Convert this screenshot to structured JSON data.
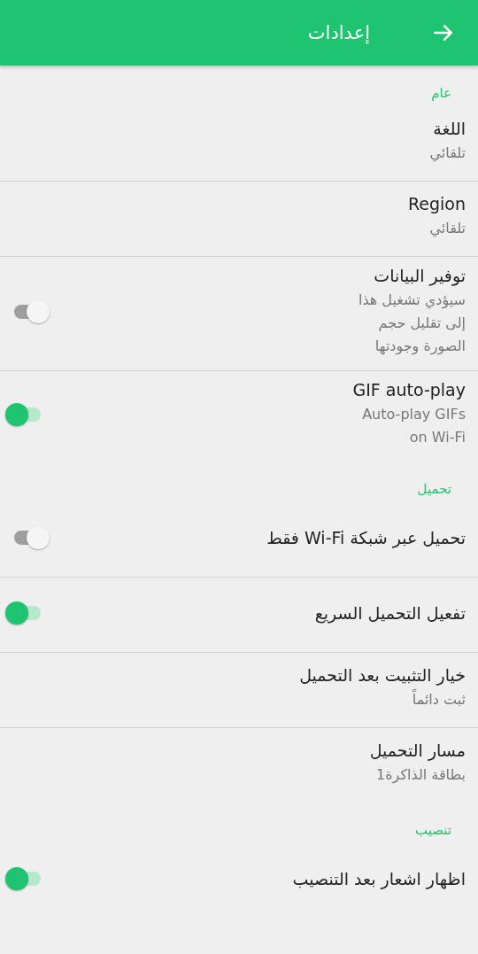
{
  "app_bar": {
    "title": "إعدادات"
  },
  "sections": [
    {
      "title": "عام",
      "items": [
        {
          "kind": "text",
          "title": "اللغة",
          "summary": "تلقائي"
        },
        {
          "kind": "text",
          "title": "Region",
          "summary": "تلقائي"
        },
        {
          "kind": "toggle",
          "title": "توفير البيانات",
          "summary": "سيؤدي تشغيل هذا إلى تقليل حجم الصورة وجودتها",
          "on": false
        },
        {
          "kind": "toggle",
          "title": "GIF auto-play",
          "summary": "Auto-play GIFs on Wi-Fi",
          "on": true
        }
      ]
    },
    {
      "title": "تحميل",
      "items": [
        {
          "kind": "toggle",
          "title": "تحميل عبر شبكة Wi-Fi فقط",
          "on": false
        },
        {
          "kind": "toggle",
          "title": "تفعيل التحميل السريع",
          "on": true
        },
        {
          "kind": "text",
          "title": "خيار التثبيت بعد التحميل",
          "summary": "ثبت دائماً"
        },
        {
          "kind": "text",
          "title": "مسار التحميل",
          "summary": "بطاقة الذاكرة1"
        }
      ]
    },
    {
      "title": "تنصيب",
      "items": [
        {
          "kind": "toggle",
          "title": "اظهار اشعار بعد التنصيب",
          "on": true
        }
      ]
    }
  ]
}
